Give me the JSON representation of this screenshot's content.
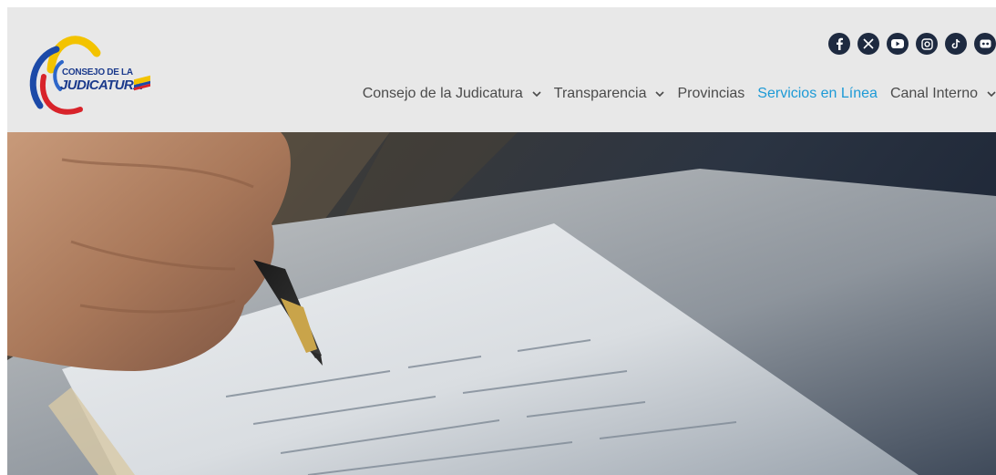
{
  "logo": {
    "line1": "CONSEJO DE LA",
    "line2": "JUDICATURA"
  },
  "social": [
    {
      "icon": "facebook-icon"
    },
    {
      "icon": "x-icon"
    },
    {
      "icon": "youtube-icon"
    },
    {
      "icon": "instagram-icon"
    },
    {
      "icon": "tiktok-icon"
    },
    {
      "icon": "flickr-icon"
    }
  ],
  "nav": {
    "items": [
      {
        "label": "Consejo de la Judicatura",
        "dropdown": true
      },
      {
        "label": "Transparencia",
        "dropdown": true
      },
      {
        "label": "Provincias",
        "dropdown": false
      },
      {
        "label": "Servicios en Línea",
        "dropdown": false,
        "active": true
      },
      {
        "label": "Canal Interno",
        "dropdown": true
      }
    ]
  },
  "colors": {
    "header_bg": "#e8e8e8",
    "nav_text": "#4b4b4b",
    "nav_active": "#1d9ad6",
    "social_bg": "#1e2a40",
    "logo_yellow": "#f3c300",
    "logo_blue": "#1c4aa8",
    "logo_red": "#d8232a"
  }
}
